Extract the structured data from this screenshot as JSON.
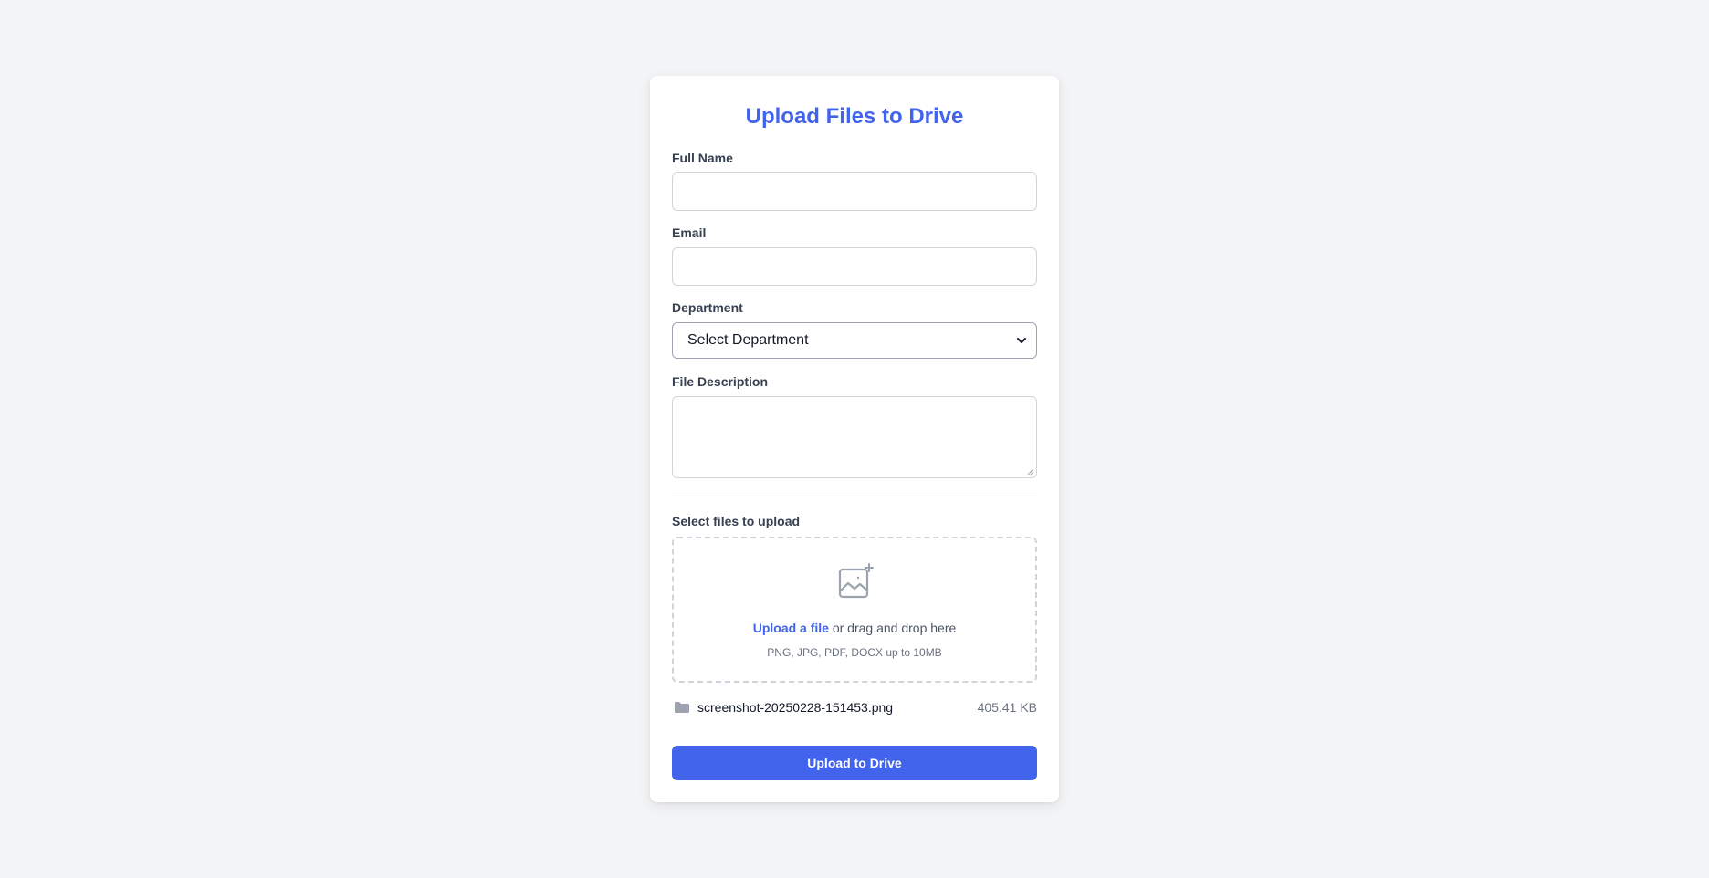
{
  "form": {
    "title": "Upload Files to Drive",
    "full_name": {
      "label": "Full Name",
      "value": ""
    },
    "email": {
      "label": "Email",
      "value": ""
    },
    "department": {
      "label": "Department",
      "selected": "Select Department"
    },
    "description": {
      "label": "File Description",
      "value": ""
    },
    "upload": {
      "label": "Select files to upload",
      "link_text": "Upload a file",
      "drag_text": " or drag and drop here",
      "hint": "PNG, JPG, PDF, DOCX up to 10MB"
    },
    "file": {
      "name": "screenshot-20250228-151453.png",
      "size": "405.41 KB"
    },
    "submit_label": "Upload to Drive"
  },
  "colors": {
    "accent": "#4263eb",
    "background": "#f3f4f6",
    "card": "#ffffff"
  },
  "icons": {
    "dropzone": "image-plus-icon",
    "file": "folder-icon",
    "select": "chevron-down-icon"
  }
}
